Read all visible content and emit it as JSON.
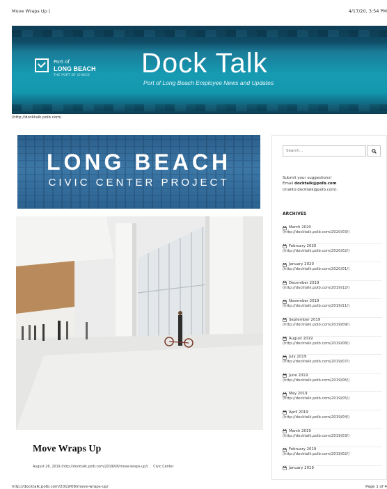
{
  "print_header": {
    "title": "Move Wraps Up |",
    "datetime": "4/17/20, 3:54 PM"
  },
  "banner": {
    "port_of": "Port of",
    "long_beach": "LONG BEACH",
    "tagline": "THE PORT OF CHOICE",
    "title": "Dock Talk",
    "subtitle": "Port of Long Beach Employee News and Updates"
  },
  "home_link": "(http://docktalk.polb.com)",
  "civic_banner": {
    "line1": "LONG BEACH",
    "line2": "CIVIC CENTER PROJECT"
  },
  "article": {
    "title": "Move Wraps Up",
    "date": "August 26, 2019 (http://docktalk.polb.com/2019/08/move-wraps-up/)",
    "category": "Civic Center"
  },
  "sidebar": {
    "search_placeholder": "Search...",
    "suggest_line1": "Submit your suggestions!",
    "email_prefix": "Email ",
    "email": "docktalk@polb.com",
    "mailto": "(mailto:docktalk@polb.com).",
    "archives_heading": "ARCHIVES",
    "archives": [
      {
        "month": "March 2020",
        "url": "(http://docktalk.polb.com/2020/03/)"
      },
      {
        "month": "February 2020",
        "url": "(http://docktalk.polb.com/2020/02/)"
      },
      {
        "month": "January 2020",
        "url": "(http://docktalk.polb.com/2020/01/)"
      },
      {
        "month": "December 2019",
        "url": "(http://docktalk.polb.com/2019/12/)"
      },
      {
        "month": "November 2019",
        "url": "(http://docktalk.polb.com/2019/11/)"
      },
      {
        "month": "September 2019",
        "url": "(http://docktalk.polb.com/2019/09/)"
      },
      {
        "month": "August 2019",
        "url": "(http://docktalk.polb.com/2019/08/)"
      },
      {
        "month": "July 2019",
        "url": "(http://docktalk.polb.com/2019/07/)"
      },
      {
        "month": "June 2019",
        "url": "(http://docktalk.polb.com/2019/06/)"
      },
      {
        "month": "May 2019",
        "url": "(http://docktalk.polb.com/2019/05/)"
      },
      {
        "month": "April 2019",
        "url": "(http://docktalk.polb.com/2019/04/)"
      },
      {
        "month": "March 2019",
        "url": "(http://docktalk.polb.com/2019/03/)"
      },
      {
        "month": "February 2019",
        "url": "(http://docktalk.polb.com/2019/02/)"
      },
      {
        "month": "January 2019",
        "url": ""
      }
    ]
  },
  "print_footer": {
    "url": "http://docktalk.polb.com/2019/08/move-wraps-up/",
    "page": "Page 1 of 4"
  }
}
